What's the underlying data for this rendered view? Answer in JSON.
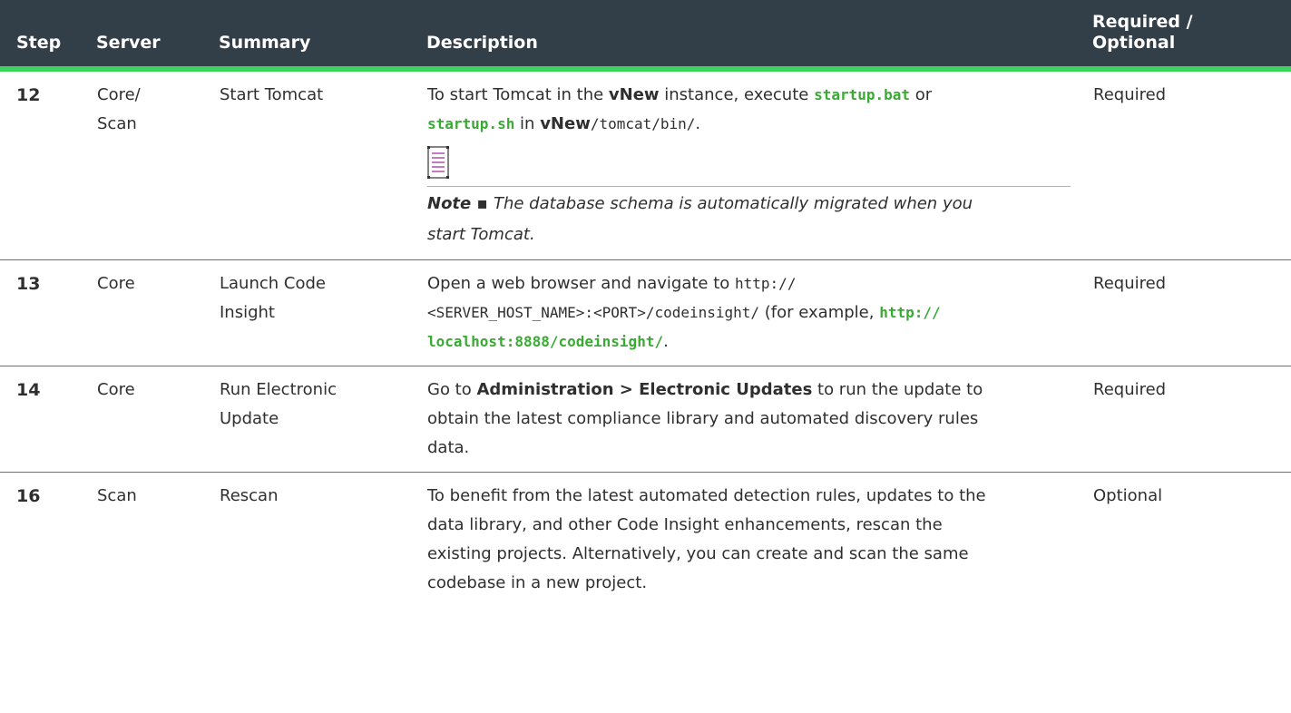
{
  "header": {
    "step": "Step",
    "server": "Server",
    "summary": "Summary",
    "description": "Description",
    "required_line1": "Required /",
    "required_line2": "Optional"
  },
  "rows": [
    {
      "step": "12",
      "server_line1": "Core/",
      "server_line2": "Scan",
      "summary": "Start Tomcat",
      "desc": {
        "t1": "To start Tomcat in the ",
        "t2": "vNew",
        "t3": " instance, execute ",
        "t4": "startup.bat",
        "t5": " or",
        "t6": "startup.sh",
        "t7": " in ",
        "t8": "vNew",
        "t9": "/tomcat/bin/",
        "t10": "."
      },
      "note_label": "Note",
      "note_bullet": " ▪ ",
      "note_line1": "The database schema is automatically migrated when you",
      "note_line2": "start Tomcat.",
      "required": "Required"
    },
    {
      "step": "13",
      "server": "Core",
      "summary_line1": "Launch Code",
      "summary_line2": "Insight",
      "desc": {
        "t1": "Open a web browser and navigate to ",
        "t2": "http://",
        "t3": "<SERVER_HOST_NAME>:<PORT>/codeinsight/",
        "t4": " (for example, ",
        "t5": "http://",
        "t6": "localhost:8888/codeinsight/",
        "t7": "."
      },
      "required": "Required"
    },
    {
      "step": "14",
      "server": "Core",
      "summary_line1": "Run Electronic",
      "summary_line2": "Update",
      "desc": {
        "t1": "Go to ",
        "t2": "Administration > Electronic Updates",
        "t3": " to run the update to",
        "line2": "obtain the latest compliance library and automated discovery rules",
        "line3": "data."
      },
      "required": "Required"
    },
    {
      "step": "16",
      "server": "Scan",
      "summary": "Rescan",
      "desc": {
        "line1": "To benefit from the latest automated detection rules, updates to the",
        "line2": "data library, and other Code Insight enhancements, rescan the",
        "line3": "existing projects. Alternatively, you can create and scan the same",
        "line4": "codebase in a new project."
      },
      "required": "Optional"
    }
  ],
  "colors": {
    "header_bg": "#323e48",
    "header_rule": "#3ad45b",
    "link_green": "#3aaa35",
    "note_icon": "#b04fb0"
  },
  "icons": {
    "note": "note-icon"
  }
}
